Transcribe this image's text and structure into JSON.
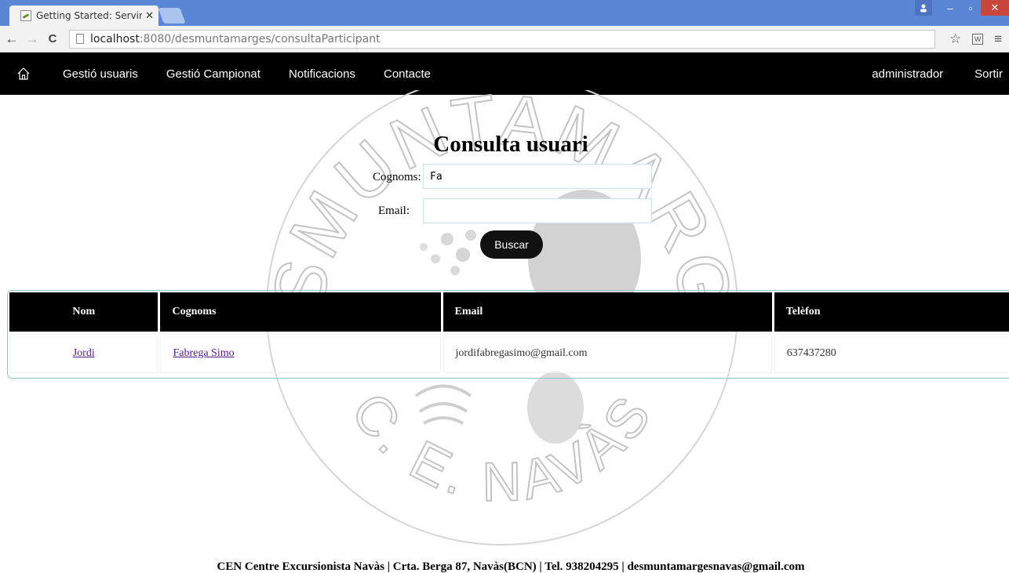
{
  "browser": {
    "tab_title": "Getting Started: Serving W",
    "url_host": "localhost",
    "url_path": ":8080/desmuntamarges/consultaParticipant"
  },
  "nav": {
    "items": [
      "Gestió usuaris",
      "Gestió Campionat",
      "Notificacions",
      "Contacte"
    ],
    "user": "administrador",
    "logout": "Sortir"
  },
  "watermark": {
    "top_text": "DESMUNTAMARGES",
    "bottom_text": "C. E. NAVÀS"
  },
  "form": {
    "title": "Consulta usuari",
    "cognoms_label": "Cognoms:",
    "cognoms_value": "Fa",
    "email_label": "Email:",
    "email_value": "",
    "submit_label": "Buscar"
  },
  "table": {
    "headers": [
      "Nom",
      "Cognoms",
      "Email",
      "Telèfon"
    ],
    "rows": [
      {
        "nom": "Jordi",
        "cognoms": "Fabrega Simo",
        "email": "jordifabregasimo@gmail.com",
        "telefon": "637437280"
      }
    ]
  },
  "footer": "CEN Centre Excursionista Navàs | Crta. Berga 87, Navàs(BCN) | Tel. 938204295 | desmuntamargesnavas@gmail.com"
}
